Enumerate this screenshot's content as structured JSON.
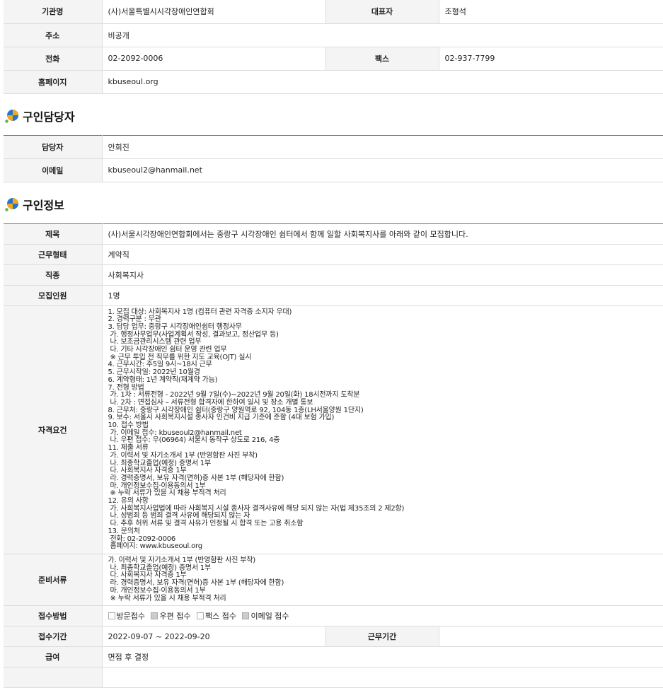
{
  "org": {
    "name_label": "기관명",
    "name": "(사)서울특별시시각장애인연합회",
    "rep_label": "대표자",
    "rep": "조형석",
    "addr_label": "주소",
    "addr": "비공개",
    "phone_label": "전화",
    "phone": "02-2092-0006",
    "fax_label": "팩스",
    "fax": "02-937-7799",
    "home_label": "홈페이지",
    "home": "kbuseoul.org"
  },
  "contact_section": {
    "title": "구인담당자",
    "icon": "section-bullet-icon"
  },
  "contact": {
    "person_label": "담당자",
    "person": "안희진",
    "email_label": "이메일",
    "email": "kbuseoul2@hanmail.net"
  },
  "job_section": {
    "title": "구인정보",
    "icon": "section-bullet-icon"
  },
  "job": {
    "title_label": "제목",
    "title": "(사)서울시각장애인연합회에서는 중랑구 시각장애인 쉼터에서 함께 일할 사회복지사를 아래와 같이 모집합니다.",
    "type_label": "근무형태",
    "type": "계약직",
    "occupation_label": "직종",
    "occupation": "사회복지사",
    "headcount_label": "모집인원",
    "headcount": "1명",
    "requirements_label": "자격요건",
    "requirements": "1. 모집 대상: 사회복지사 1명 (컴퓨터 관련 자격증 소지자 우대)\n2. 경력구분 : 무관\n3. 담당 업무: 중랑구 시각장애인쉼터 행정사무\n 가. 행정사무업무(사업계획서 작성, 결과보고, 정산업무 등)\n 나. 보조금관리시스템 관련 업무\n 다. 기타 시각장애인 쉼터 운영 관련 업무\n ※ 근무 투입 전 직무를 위한 지도 교육(OJT) 실시\n4. 근무시간: 주5일 9시~18시 근무\n5. 근무시작일: 2022년 10월경\n6. 계약형태: 1년 계약직(재계약 가능)\n7. 전형 방법\n 가. 1차 : 서류전형 - 2022년 9월 7일(수)~2022년 9월 20일(화) 18시전까지 도착분\n 나. 2차 : 면접심사 – 서류전형 합격자에 한하여 일시 및 장소 개별 통보\n8. 근무처: 중랑구 시각장애인 쉼터(중랑구 양원역로 92, 104동 1층(LH서울양원 1단지)\n9. 보수: 서울시 사회복지시설 종사자 인건비 지급 기준에 준함 (4대 보험 가입)\n10. 접수 방법\n 가. 이메일 접수: kbuseoul2@hanmail.net\n 나. 우편 접수: 우(06964) 서울시 동작구 상도로 216, 4층\n11. 제출 서류\n 가. 이력서 및 자기소개서 1부 (반영함판 사진 부착)\n 나. 최종학교졸업(예정) 증명서 1부\n 다. 사회복지사 자격증 1부\n 라. 경력증명서, 보유 자격(면허)증 사본 1부 (해당자에 한함)\n 마. 개인정보수집·이용동의서 1부\n ※ 누락 서류가 있을 시 채용 부적격 처리\n12. 유의 사항\n 가. 사회복지사업법에 따라 사회복지 시설 종사자 결격사유에 해당 되지 않는 자(법 제35조의 2 제2항)\n 나. 성범죄 등 범죄 결격 사유에 해당되지 않는 자\n 다. 추후 허위 서류 및 결격 사유가 인정될 시 합격 또는 고용 취소함\n13. 문의처\n 전화: 02-2092-0006\n 홈페이지: www.kbuseoul.org",
    "docs_label": "준비서류",
    "docs": "가. 이력서 및 자기소개서 1부 (반영함판 사진 부착)\n 나. 최종학교졸업(예정) 증명서 1부\n 다. 사회복지사 자격증 1부\n 라. 경력증명서, 보유 자격(면허)증 사본 1부 (해당자에 한함)\n 마. 개인정보수집·이용동의서 1부\n ※ 누락 서류가 있을 시 채용 부적격 처리",
    "method_label": "접수방법",
    "methods": [
      {
        "label": "방문접수",
        "checked": false
      },
      {
        "label": "우편 접수",
        "checked": true
      },
      {
        "label": "팩스 접수",
        "checked": false
      },
      {
        "label": "이메일 접수",
        "checked": true
      }
    ],
    "period_label": "접수기간",
    "period": "2022-09-07 ~ 2022-09-20",
    "workperiod_label": "근무기간",
    "workperiod": "",
    "salary_label": "급여",
    "salary": "면접 후 결정"
  }
}
